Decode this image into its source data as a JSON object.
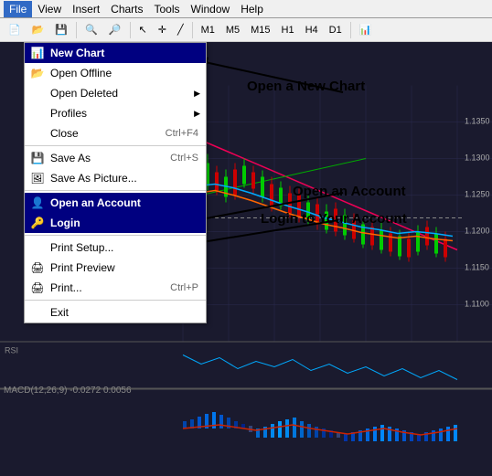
{
  "menubar": {
    "items": [
      "File",
      "View",
      "Insert",
      "Charts",
      "Tools",
      "Window",
      "Help"
    ]
  },
  "dropdown": {
    "items": [
      {
        "label": "New Chart",
        "shortcut": "",
        "highlighted": true,
        "icon": "chart-icon",
        "hasSub": false
      },
      {
        "label": "Open Offline",
        "shortcut": "",
        "highlighted": false,
        "icon": "folder-icon",
        "hasSub": false
      },
      {
        "label": "Open Deleted",
        "shortcut": "",
        "highlighted": false,
        "icon": "",
        "hasSub": true
      },
      {
        "label": "Profiles",
        "shortcut": "",
        "highlighted": false,
        "icon": "",
        "hasSub": true
      },
      {
        "label": "Close",
        "shortcut": "Ctrl+F4",
        "highlighted": false,
        "icon": "",
        "hasSub": false
      },
      {
        "separator": true
      },
      {
        "label": "Save As",
        "shortcut": "Ctrl+S",
        "highlighted": false,
        "icon": "save-icon",
        "hasSub": false
      },
      {
        "label": "Save As Picture...",
        "shortcut": "",
        "highlighted": false,
        "icon": "picture-icon",
        "hasSub": false
      },
      {
        "separator": true
      },
      {
        "label": "Open an Account",
        "shortcut": "",
        "highlighted": true,
        "icon": "account-icon",
        "hasSub": false
      },
      {
        "label": "Login",
        "shortcut": "",
        "highlighted": true,
        "icon": "login-icon",
        "hasSub": false
      },
      {
        "separator": true
      },
      {
        "label": "Print Setup...",
        "shortcut": "",
        "highlighted": false,
        "icon": "",
        "hasSub": false
      },
      {
        "label": "Print Preview",
        "shortcut": "",
        "highlighted": false,
        "icon": "preview-icon",
        "hasSub": false
      },
      {
        "label": "Print...",
        "shortcut": "Ctrl+P",
        "highlighted": false,
        "icon": "print-icon",
        "hasSub": false
      },
      {
        "separator": true
      },
      {
        "label": "Exit",
        "shortcut": "",
        "highlighted": false,
        "icon": "",
        "hasSub": false
      }
    ]
  },
  "annotations": {
    "new_chart": "Open a New Chart",
    "open_account": "Open an Account",
    "login": "Login to Your Account"
  },
  "chart": {
    "macd_label": "MACD(12,26,9) -0.0272  0.0056"
  }
}
